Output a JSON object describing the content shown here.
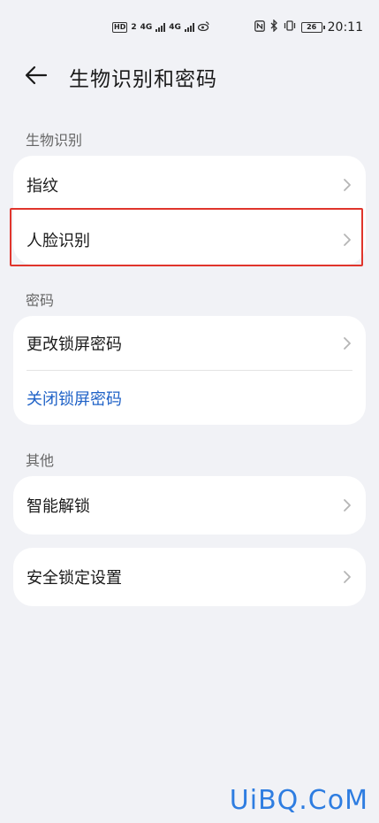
{
  "status_bar": {
    "left_badge": "HD",
    "left_badge_2": "2",
    "net1": "4G",
    "net2": "4G",
    "battery": "26",
    "time": "20:11"
  },
  "header": {
    "title": "生物识别和密码"
  },
  "sections": {
    "biometrics": {
      "label": "生物识别",
      "items": [
        {
          "label": "指纹"
        },
        {
          "label": "人脸识别"
        }
      ]
    },
    "password": {
      "label": "密码",
      "items": [
        {
          "label": "更改锁屏密码"
        },
        {
          "label": "关闭锁屏密码"
        }
      ]
    },
    "other": {
      "label": "其他",
      "items": [
        {
          "label": "智能解锁"
        },
        {
          "label": "安全锁定设置"
        }
      ]
    }
  },
  "watermark": "UiBQ.CoM",
  "colors": {
    "background": "#f1f2f6",
    "card": "#ffffff",
    "link": "#1f62c7",
    "highlight": "#e0352c",
    "watermark": "#2e7de1"
  }
}
